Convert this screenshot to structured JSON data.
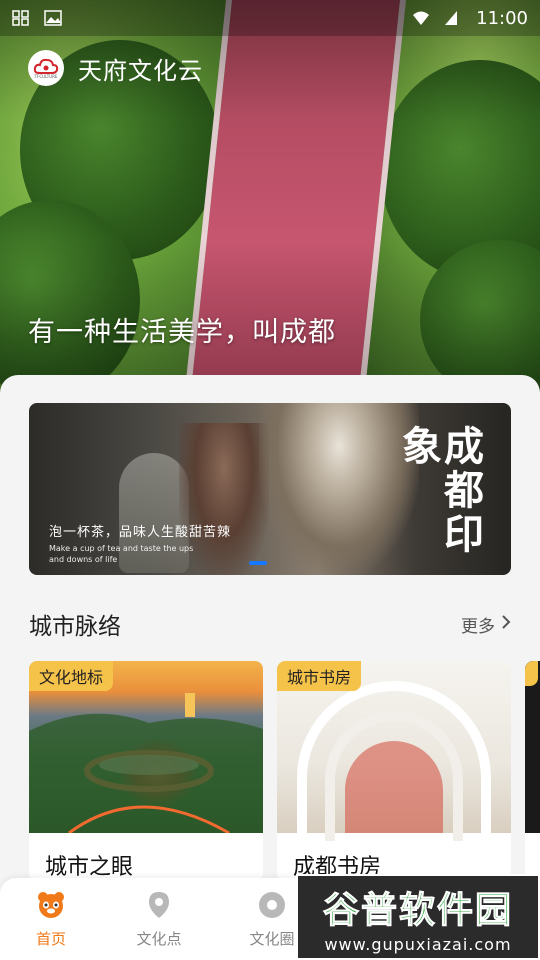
{
  "status_bar": {
    "time": "11:00"
  },
  "app": {
    "name": "天府文化云"
  },
  "hero": {
    "slogan": "有一种生活美学，叫成都"
  },
  "banner": {
    "title_calligraphy": "成都印象",
    "caption_zh": "泡一杯茶，品味人生酸甜苦辣",
    "caption_en": "Make a cup of tea and taste the ups and downs of life",
    "active_index": 0
  },
  "section": {
    "title": "城市脉络",
    "more_label": "更多"
  },
  "cards": [
    {
      "tag": "文化地标",
      "name": "城市之眼"
    },
    {
      "tag": "城市书房",
      "name": "成都书房"
    }
  ],
  "bottom_nav": {
    "items": [
      {
        "label": "首页",
        "icon": "panda-icon",
        "active": true
      },
      {
        "label": "文化点",
        "icon": "location-pin-icon",
        "active": false
      },
      {
        "label": "文化圈",
        "icon": "circle-icon",
        "active": false
      }
    ]
  },
  "watermark": {
    "title": "谷普软件园",
    "url": "www.gupuxiazai.com"
  },
  "colors": {
    "accent": "#f07a1a",
    "tag_bg": "#f5c24a",
    "dot": "#1677ff"
  }
}
